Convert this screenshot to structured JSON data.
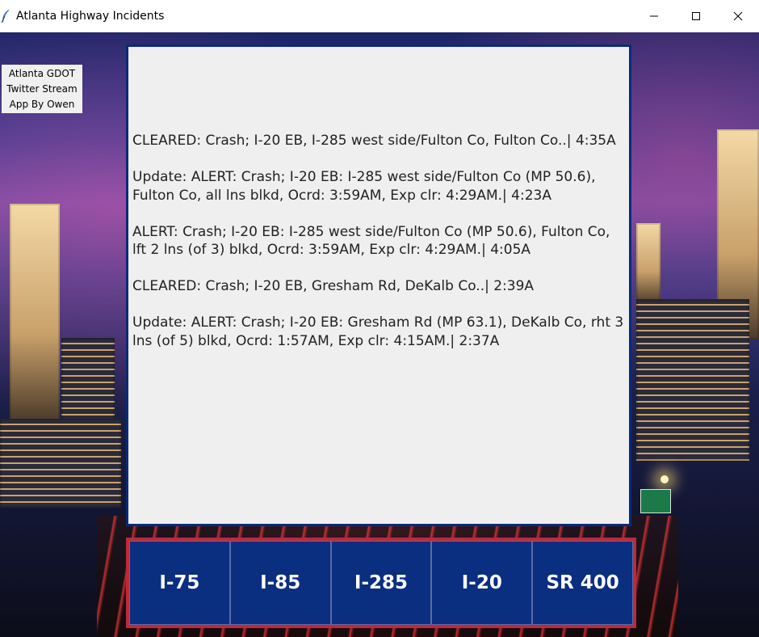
{
  "window": {
    "title": "Atlanta Highway Incidents"
  },
  "credit": {
    "line1": "Atlanta GDOT",
    "line2": "Twitter Stream",
    "line3": "App By Owen"
  },
  "feed": {
    "tweets": [
      "CLEARED: Crash; I-20 EB, I-285 west side/Fulton Co, Fulton Co..| 4:35A",
      "Update: ALERT: Crash; I-20 EB: I-285 west side/Fulton Co (MP 50.6), Fulton Co, all lns blkd, Ocrd: 3:59AM, Exp clr: 4:29AM.| 4:23A",
      "ALERT: Crash; I-20 EB: I-285 west side/Fulton Co (MP 50.6), Fulton Co, lft 2 lns (of 3) blkd, Ocrd: 3:59AM, Exp clr: 4:29AM.| 4:05A",
      "CLEARED: Crash; I-20 EB, Gresham Rd, DeKalb Co..| 2:39A",
      "Update: ALERT: Crash; I-20 EB: Gresham Rd (MP 63.1), DeKalb Co, rht 3 lns (of 5) blkd, Ocrd: 1:57AM, Exp clr: 4:15AM.| 2:37A"
    ]
  },
  "highways": {
    "buttons": [
      "I-75",
      "I-85",
      "I-285",
      "I-20",
      "SR 400"
    ]
  },
  "colors": {
    "feed_border": "#0a2a7a",
    "button_bg": "#0a2e80",
    "button_bar_border": "#c0283a"
  },
  "icons": {
    "app": "feather-icon",
    "minimize": "minimize-icon",
    "maximize": "maximize-icon",
    "close": "close-icon"
  }
}
